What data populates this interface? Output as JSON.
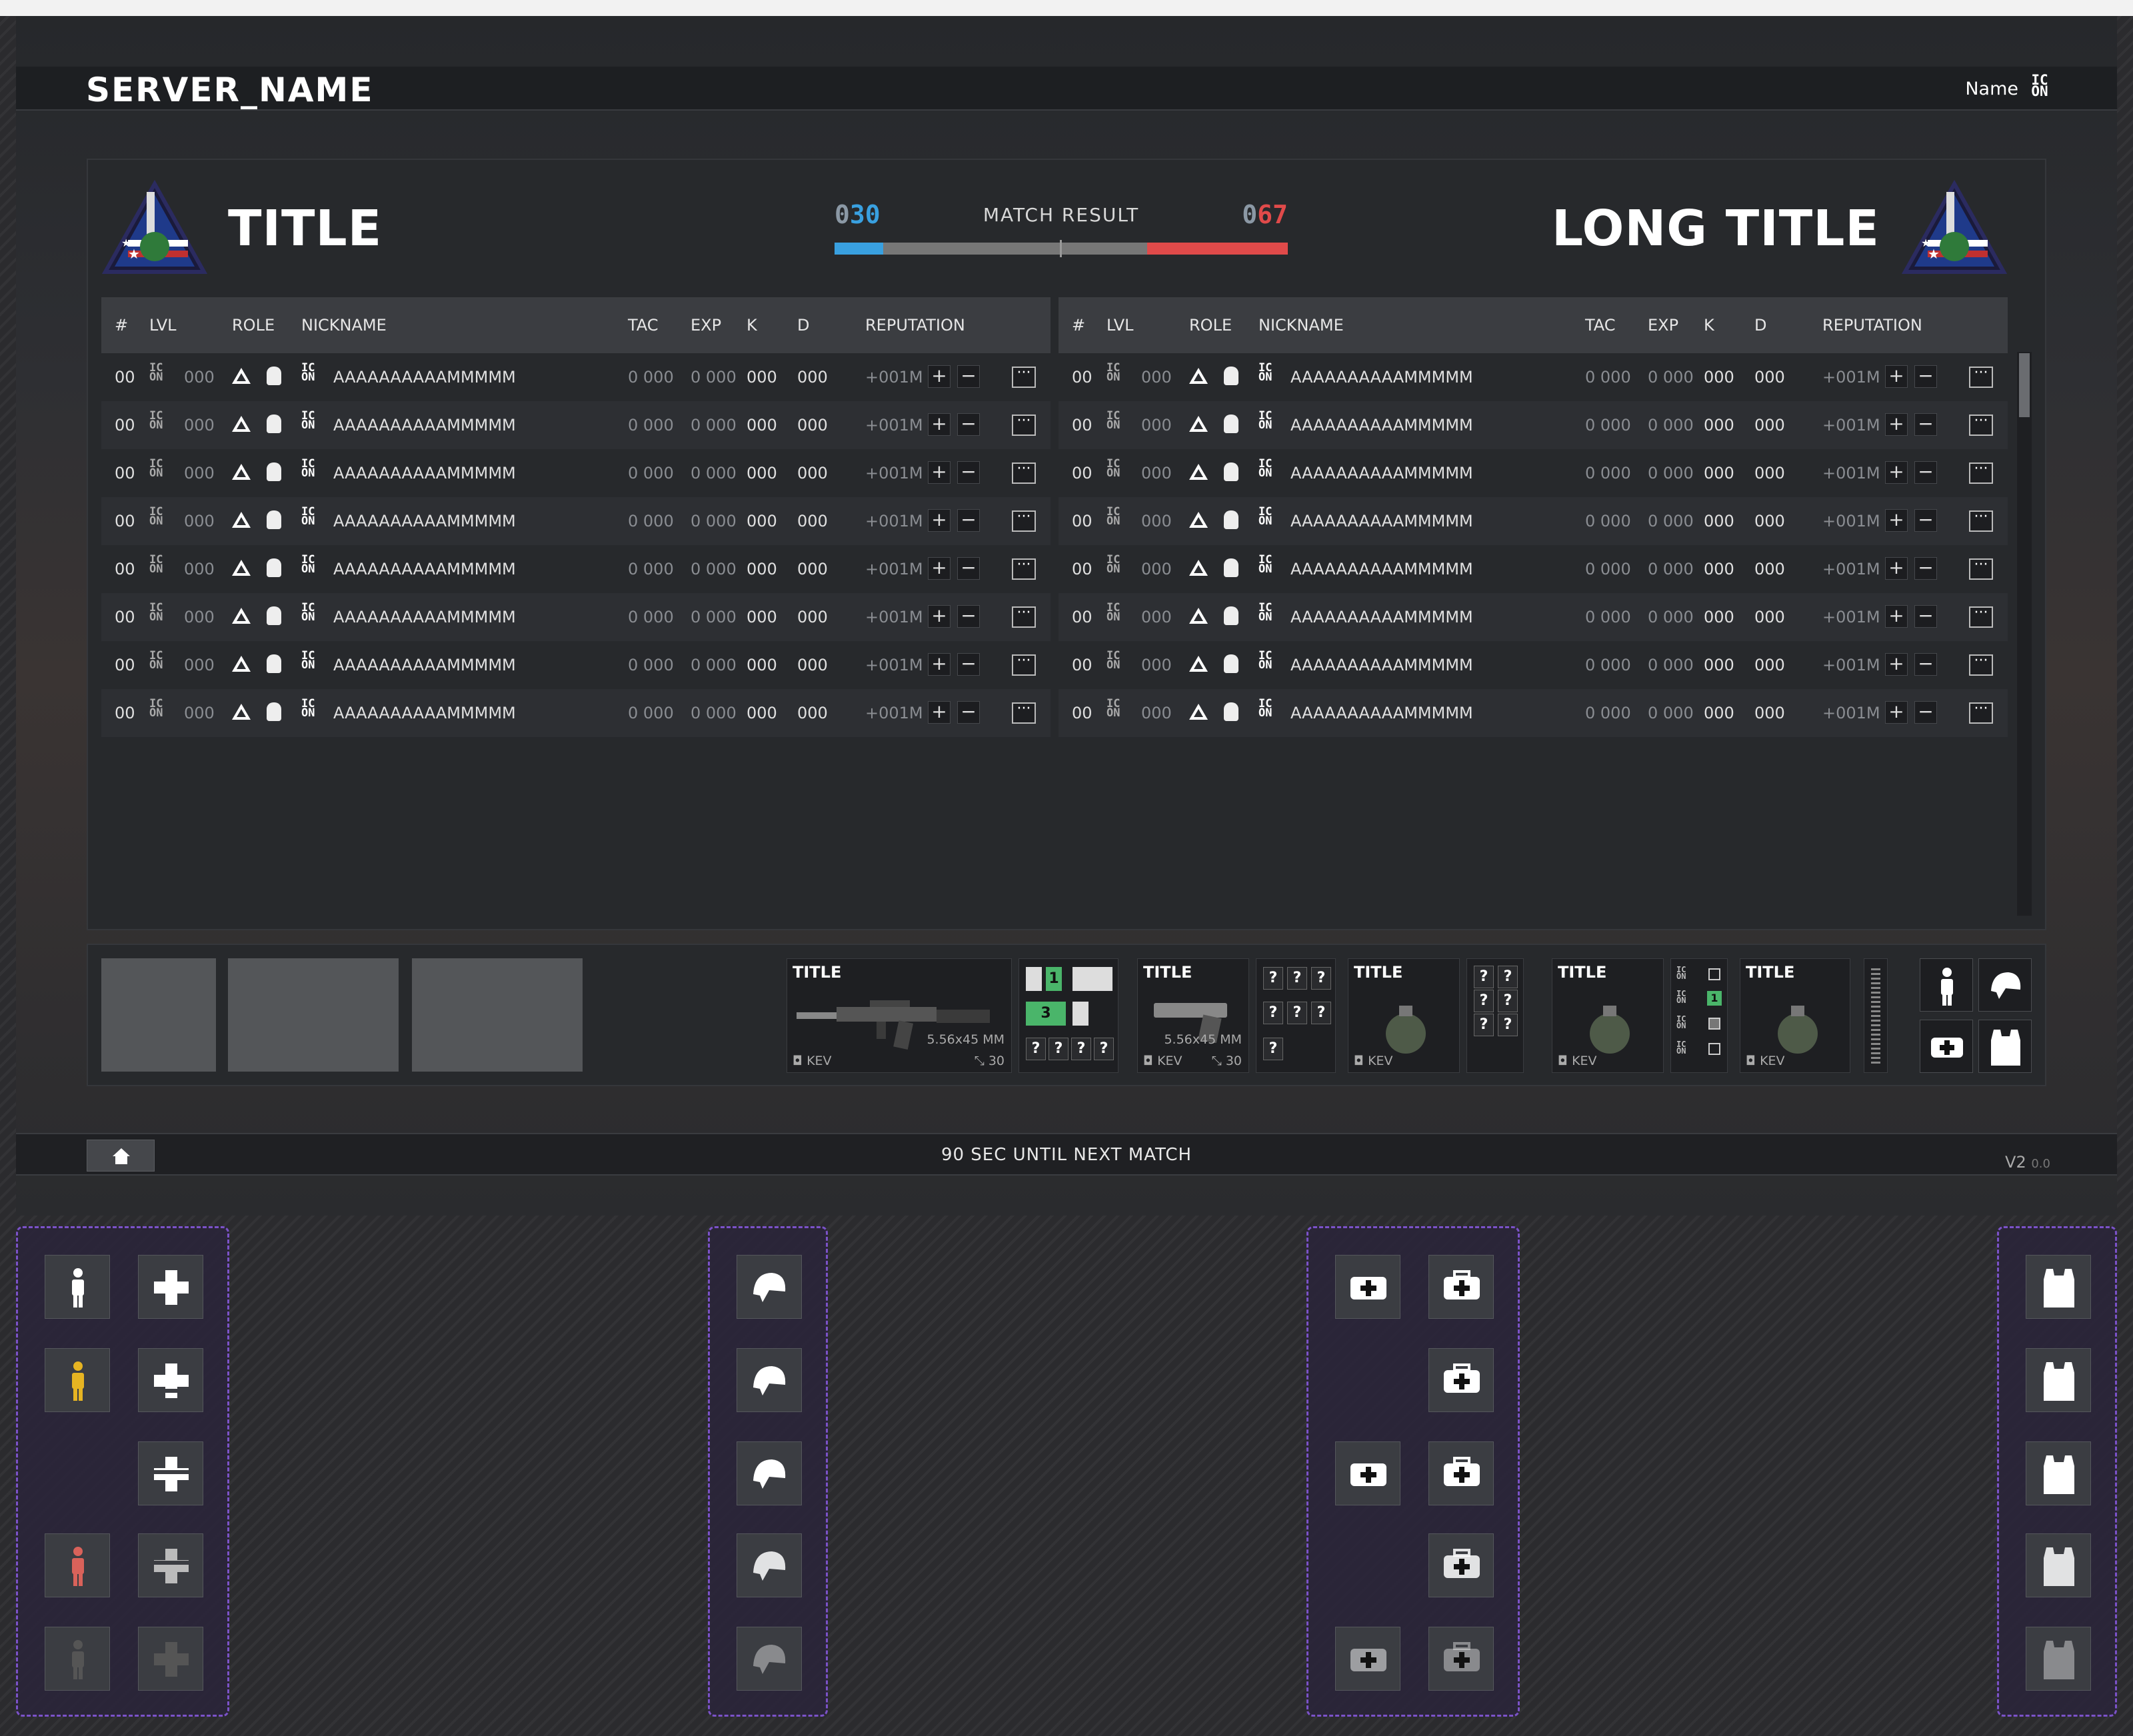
{
  "header": {
    "server_name": "SERVER_NAME",
    "user_name": "Name",
    "user_icon_text": "IC ON"
  },
  "match": {
    "left_team": {
      "title": "TITLE",
      "score_prefix": "0",
      "score": "30",
      "color": "#39a0e0"
    },
    "right_team": {
      "title": "LONG TITLE",
      "score_prefix": "0",
      "score": "67",
      "color": "#e04a4a"
    },
    "result_label": "MATCH RESULT",
    "left_fraction": 0.3,
    "right_fraction": 0.67
  },
  "table": {
    "columns": [
      "#",
      "LVL",
      "ROLE",
      "NICKNAME",
      "TAC",
      "EXP",
      "K",
      "D",
      "REPUTATION"
    ],
    "row_template": {
      "num": "00",
      "lvl": "000",
      "icon_text": "IC ON",
      "nickname": "AAAAAAAAAAMMMMM",
      "tac": "0 000",
      "exp": "0 000",
      "k": "000",
      "d": "000",
      "rep": "+001M",
      "plus": "+",
      "minus": "−",
      "more": "···"
    },
    "rows_per_team": 8
  },
  "loadout": {
    "cards": [
      {
        "title": "TITLE",
        "kev": "KEV",
        "caliber": "5.56x45 MM",
        "ammo": "30"
      },
      {
        "title": "TITLE",
        "kev": "KEV",
        "caliber": "5.56x45 MM",
        "ammo": "30"
      },
      {
        "title": "TITLE",
        "kev": "KEV"
      },
      {
        "title": "TITLE",
        "kev": "KEV"
      },
      {
        "title": "TITLE",
        "kev": "KEV"
      }
    ],
    "slot_numbers": [
      "1",
      "3"
    ],
    "unknown": "?",
    "slot_icon_text": "IC ON",
    "slot_number_small": "1"
  },
  "footer": {
    "next_match": "90 SEC UNTIL NEXT MATCH",
    "version_major": "V2",
    "version_minor": "0.0"
  },
  "colors": {
    "health_full": "#ffffff",
    "health_yellow": "#e6b422",
    "health_red": "#d9625a",
    "health_dead": "#555555"
  }
}
